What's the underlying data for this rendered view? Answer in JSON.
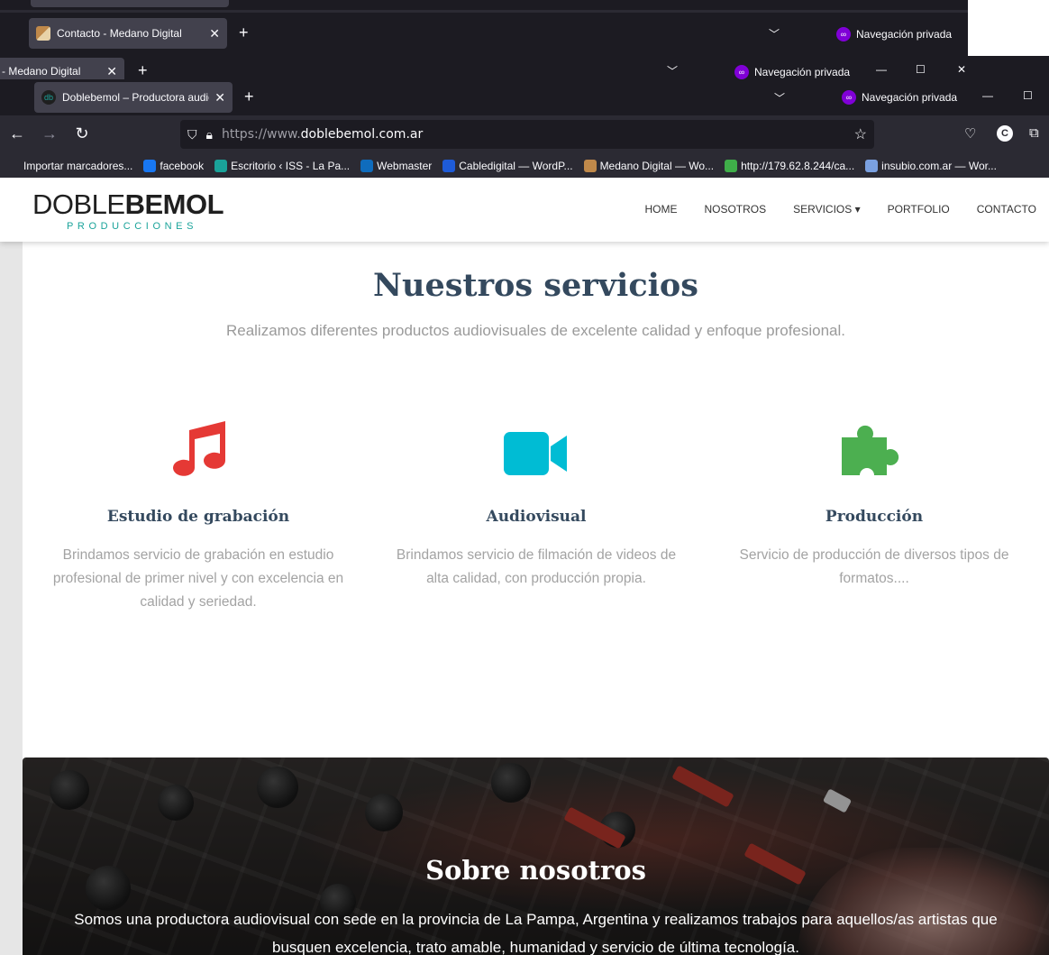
{
  "background_windows": {
    "window2": {
      "tab_title": "Contacto - Medano Digital",
      "private_label": "Navegación privada"
    },
    "window3": {
      "tab_title": "- Medano Digital",
      "private_label": "Navegación privada"
    }
  },
  "browser": {
    "active_tab_title": "Doblebemol – Productora audiovisual",
    "private_label": "Navegación privada",
    "url_prefix": "https://www.",
    "url_domain": "doblebemol.com.ar",
    "account_initial": "C",
    "bookmarks": [
      {
        "label": "Importar marcadores...",
        "icon": "import-icon",
        "color": "#2b2a33"
      },
      {
        "label": "facebook",
        "icon": "facebook-icon",
        "color": "#1877f2"
      },
      {
        "label": "Escritorio ‹ ISS - La Pa...",
        "icon": "iss-icon",
        "color": "#1aa39a"
      },
      {
        "label": "Webmaster",
        "icon": "outlook-icon",
        "color": "#0f6cbd"
      },
      {
        "label": "Cabledigital — WordP...",
        "icon": "cabledigital-icon",
        "color": "#1e5bd8"
      },
      {
        "label": "Medano Digital — Wo...",
        "icon": "medano-icon",
        "color": "#c0894a"
      },
      {
        "label": "http://179.62.8.244/ca...",
        "icon": "leaf-icon",
        "color": "#3fae49"
      },
      {
        "label": "insubio.com.ar — Wor...",
        "icon": "insubio-icon",
        "color": "#7aa0e0"
      }
    ]
  },
  "site": {
    "logo_word1": "DOBLE",
    "logo_word2": "BEMOL",
    "logo_sub": "PRODUCCIONES",
    "menu": [
      {
        "label": "HOME"
      },
      {
        "label": "NOSOTROS"
      },
      {
        "label": "SERVICIOS ▾"
      },
      {
        "label": "PORTFOLIO"
      },
      {
        "label": "CONTACTO"
      }
    ],
    "services_title": "Nuestros servicios",
    "services_subtitle": "Realizamos diferentes productos audiovisuales de excelente calidad y enfoque profesional.",
    "services": [
      {
        "title": "Estudio de grabación",
        "text": "Brindamos servicio de grabación en estudio profesional de primer nivel y con excelencia en calidad y seriedad.",
        "icon": "music-note-icon",
        "color": "#e53935"
      },
      {
        "title": "Audiovisual",
        "text": "Brindamos servicio de filmación de videos de alta calidad, con producción propia.",
        "icon": "video-camera-icon",
        "color": "#00bcd4"
      },
      {
        "title": "Producción",
        "text": "Servicio de producción de diversos tipos de formatos....",
        "icon": "puzzle-icon",
        "color": "#4caf50"
      }
    ],
    "about_title": "Sobre nosotros",
    "about_text": "Somos una productora audiovisual con sede en la provincia de La Pampa, Argentina y realizamos trabajos para aquellos/as artistas que busquen excelencia, trato amable, humanidad y servicio de última tecnología."
  }
}
